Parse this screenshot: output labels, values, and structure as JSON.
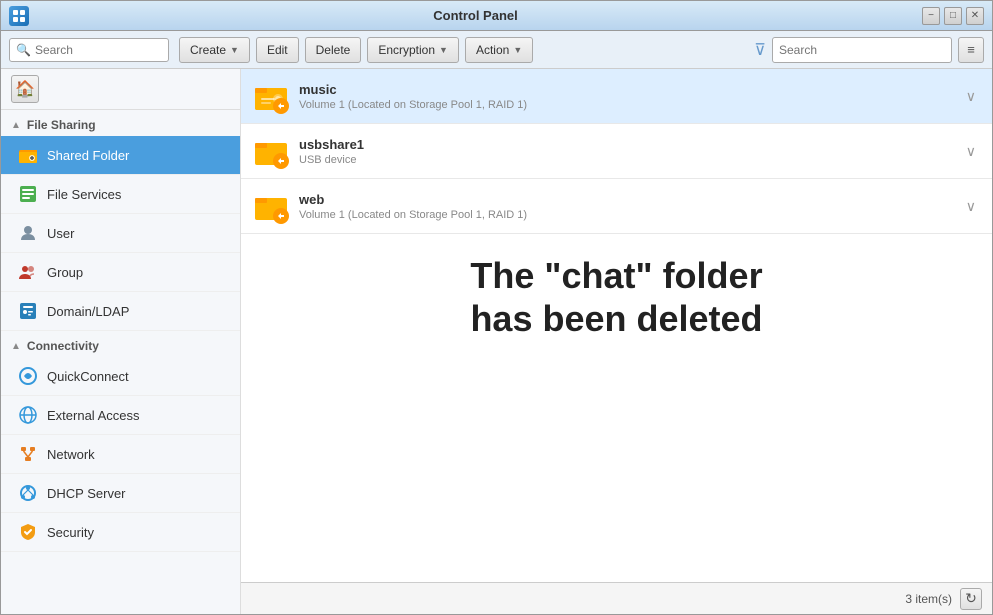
{
  "window": {
    "title": "Control Panel",
    "minimize_label": "−",
    "maximize_label": "□",
    "close_label": "✕"
  },
  "toolbar": {
    "create_label": "Create",
    "edit_label": "Edit",
    "delete_label": "Delete",
    "encryption_label": "Encryption",
    "action_label": "Action",
    "search_placeholder": "Search",
    "left_search_placeholder": "Search"
  },
  "sidebar": {
    "home_icon": "🏠",
    "file_sharing_section": "File Sharing",
    "items": [
      {
        "id": "shared-folder",
        "label": "Shared Folder",
        "active": true
      },
      {
        "id": "file-services",
        "label": "File Services",
        "active": false
      },
      {
        "id": "user",
        "label": "User",
        "active": false
      },
      {
        "id": "group",
        "label": "Group",
        "active": false
      },
      {
        "id": "domain-ldap",
        "label": "Domain/LDAP",
        "active": false
      }
    ],
    "connectivity_section": "Connectivity",
    "connectivity_items": [
      {
        "id": "quickconnect",
        "label": "QuickConnect",
        "active": false
      },
      {
        "id": "external-access",
        "label": "External Access",
        "active": false
      },
      {
        "id": "network",
        "label": "Network",
        "active": false
      },
      {
        "id": "dhcp-server",
        "label": "DHCP Server",
        "active": false
      },
      {
        "id": "security",
        "label": "Security",
        "active": false
      }
    ]
  },
  "folders": [
    {
      "id": "music",
      "name": "music",
      "subtitle": "Volume 1 (Located on Storage Pool 1, RAID 1)",
      "selected": true
    },
    {
      "id": "usbshare1",
      "name": "usbshare1",
      "subtitle": "USB device",
      "selected": false
    },
    {
      "id": "web",
      "name": "web",
      "subtitle": "Volume 1 (Located on Storage Pool 1, RAID 1)",
      "selected": false
    }
  ],
  "watermark": {
    "line1": "The \"chat\" folder",
    "line2": "has been deleted"
  },
  "status": {
    "items_count": "3 item(s)"
  }
}
